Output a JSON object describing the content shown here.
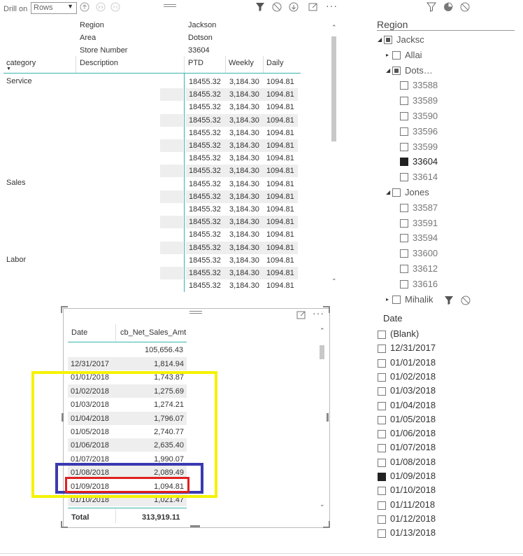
{
  "toolbar": {
    "drill_on_label": "Drill on",
    "drill_select_value": "Rows"
  },
  "matrix": {
    "header_rows": [
      {
        "label": "Region",
        "value": "Jackson"
      },
      {
        "label": "Area",
        "value": "Dotson"
      },
      {
        "label": "Store Number",
        "value": "33604"
      }
    ],
    "columns": [
      "category",
      "Description",
      "PTD",
      "Weekly",
      "Daily"
    ],
    "categories": [
      {
        "name": "Service",
        "row": 0
      },
      {
        "name": "Sales",
        "row": 8
      },
      {
        "name": "Labor",
        "row": 14
      }
    ],
    "row_values": {
      "ptd": "18455.32",
      "weekly": "3,184.30",
      "daily": "1094.81"
    },
    "row_count": 17
  },
  "table2": {
    "columns": [
      "Date",
      "cb_Net_Sales_Amt"
    ],
    "first_value": "105,656.43",
    "rows": [
      {
        "date": "12/31/2017",
        "value": "1,814.94"
      },
      {
        "date": "01/01/2018",
        "value": "1,743.87"
      },
      {
        "date": "01/02/2018",
        "value": "1,275.69"
      },
      {
        "date": "01/03/2018",
        "value": "1,274.21"
      },
      {
        "date": "01/04/2018",
        "value": "1,796.07"
      },
      {
        "date": "01/05/2018",
        "value": "2,740.77"
      },
      {
        "date": "01/06/2018",
        "value": "2,635.40"
      },
      {
        "date": "01/07/2018",
        "value": "1,990.07"
      },
      {
        "date": "01/08/2018",
        "value": "2,089.49"
      },
      {
        "date": "01/09/2018",
        "value": "1,094.81"
      },
      {
        "date": "01/10/2018",
        "value": "1,021.47"
      }
    ],
    "total_label": "Total",
    "total_value": "313,919.11"
  },
  "region_slicer": {
    "title": "Region",
    "items": [
      {
        "label": "Jacksc",
        "level": 0,
        "state": "partial",
        "arrow": "expanded"
      },
      {
        "label": "Allai",
        "level": 1,
        "state": "none",
        "arrow": "collapsed"
      },
      {
        "label": "Dots…",
        "level": 1,
        "state": "partial",
        "arrow": "expanded"
      },
      {
        "label": "33588",
        "level": 2,
        "state": "none"
      },
      {
        "label": "33589",
        "level": 2,
        "state": "none"
      },
      {
        "label": "33590",
        "level": 2,
        "state": "none"
      },
      {
        "label": "33596",
        "level": 2,
        "state": "none"
      },
      {
        "label": "33599",
        "level": 2,
        "state": "none"
      },
      {
        "label": "33604",
        "level": 2,
        "state": "checked"
      },
      {
        "label": "33614",
        "level": 2,
        "state": "none"
      },
      {
        "label": "Jones",
        "level": 1,
        "state": "none",
        "arrow": "expanded"
      },
      {
        "label": "33587",
        "level": 2,
        "state": "none"
      },
      {
        "label": "33591",
        "level": 2,
        "state": "none"
      },
      {
        "label": "33594",
        "level": 2,
        "state": "none"
      },
      {
        "label": "33600",
        "level": 2,
        "state": "none"
      },
      {
        "label": "33612",
        "level": 2,
        "state": "none"
      },
      {
        "label": "33616",
        "level": 2,
        "state": "none"
      },
      {
        "label": "Mihalik",
        "level": 1,
        "state": "none",
        "arrow": "collapsed"
      }
    ]
  },
  "date_slicer": {
    "title": "Date",
    "items": [
      {
        "label": "(Blank)",
        "state": "none"
      },
      {
        "label": "12/31/2017",
        "state": "none"
      },
      {
        "label": "01/01/2018",
        "state": "none"
      },
      {
        "label": "01/02/2018",
        "state": "none"
      },
      {
        "label": "01/03/2018",
        "state": "none"
      },
      {
        "label": "01/04/2018",
        "state": "none"
      },
      {
        "label": "01/05/2018",
        "state": "none"
      },
      {
        "label": "01/06/2018",
        "state": "none"
      },
      {
        "label": "01/07/2018",
        "state": "none"
      },
      {
        "label": "01/08/2018",
        "state": "none"
      },
      {
        "label": "01/09/2018",
        "state": "checked"
      },
      {
        "label": "01/10/2018",
        "state": "none"
      },
      {
        "label": "01/11/2018",
        "state": "none"
      },
      {
        "label": "01/12/2018",
        "state": "none"
      },
      {
        "label": "01/13/2018",
        "state": "none"
      }
    ]
  },
  "colors": {
    "teal_divider": "#3ab5ae",
    "highlight_yellow": "#f5f200",
    "highlight_blue": "#3a3ab0",
    "highlight_red": "#e02020"
  }
}
